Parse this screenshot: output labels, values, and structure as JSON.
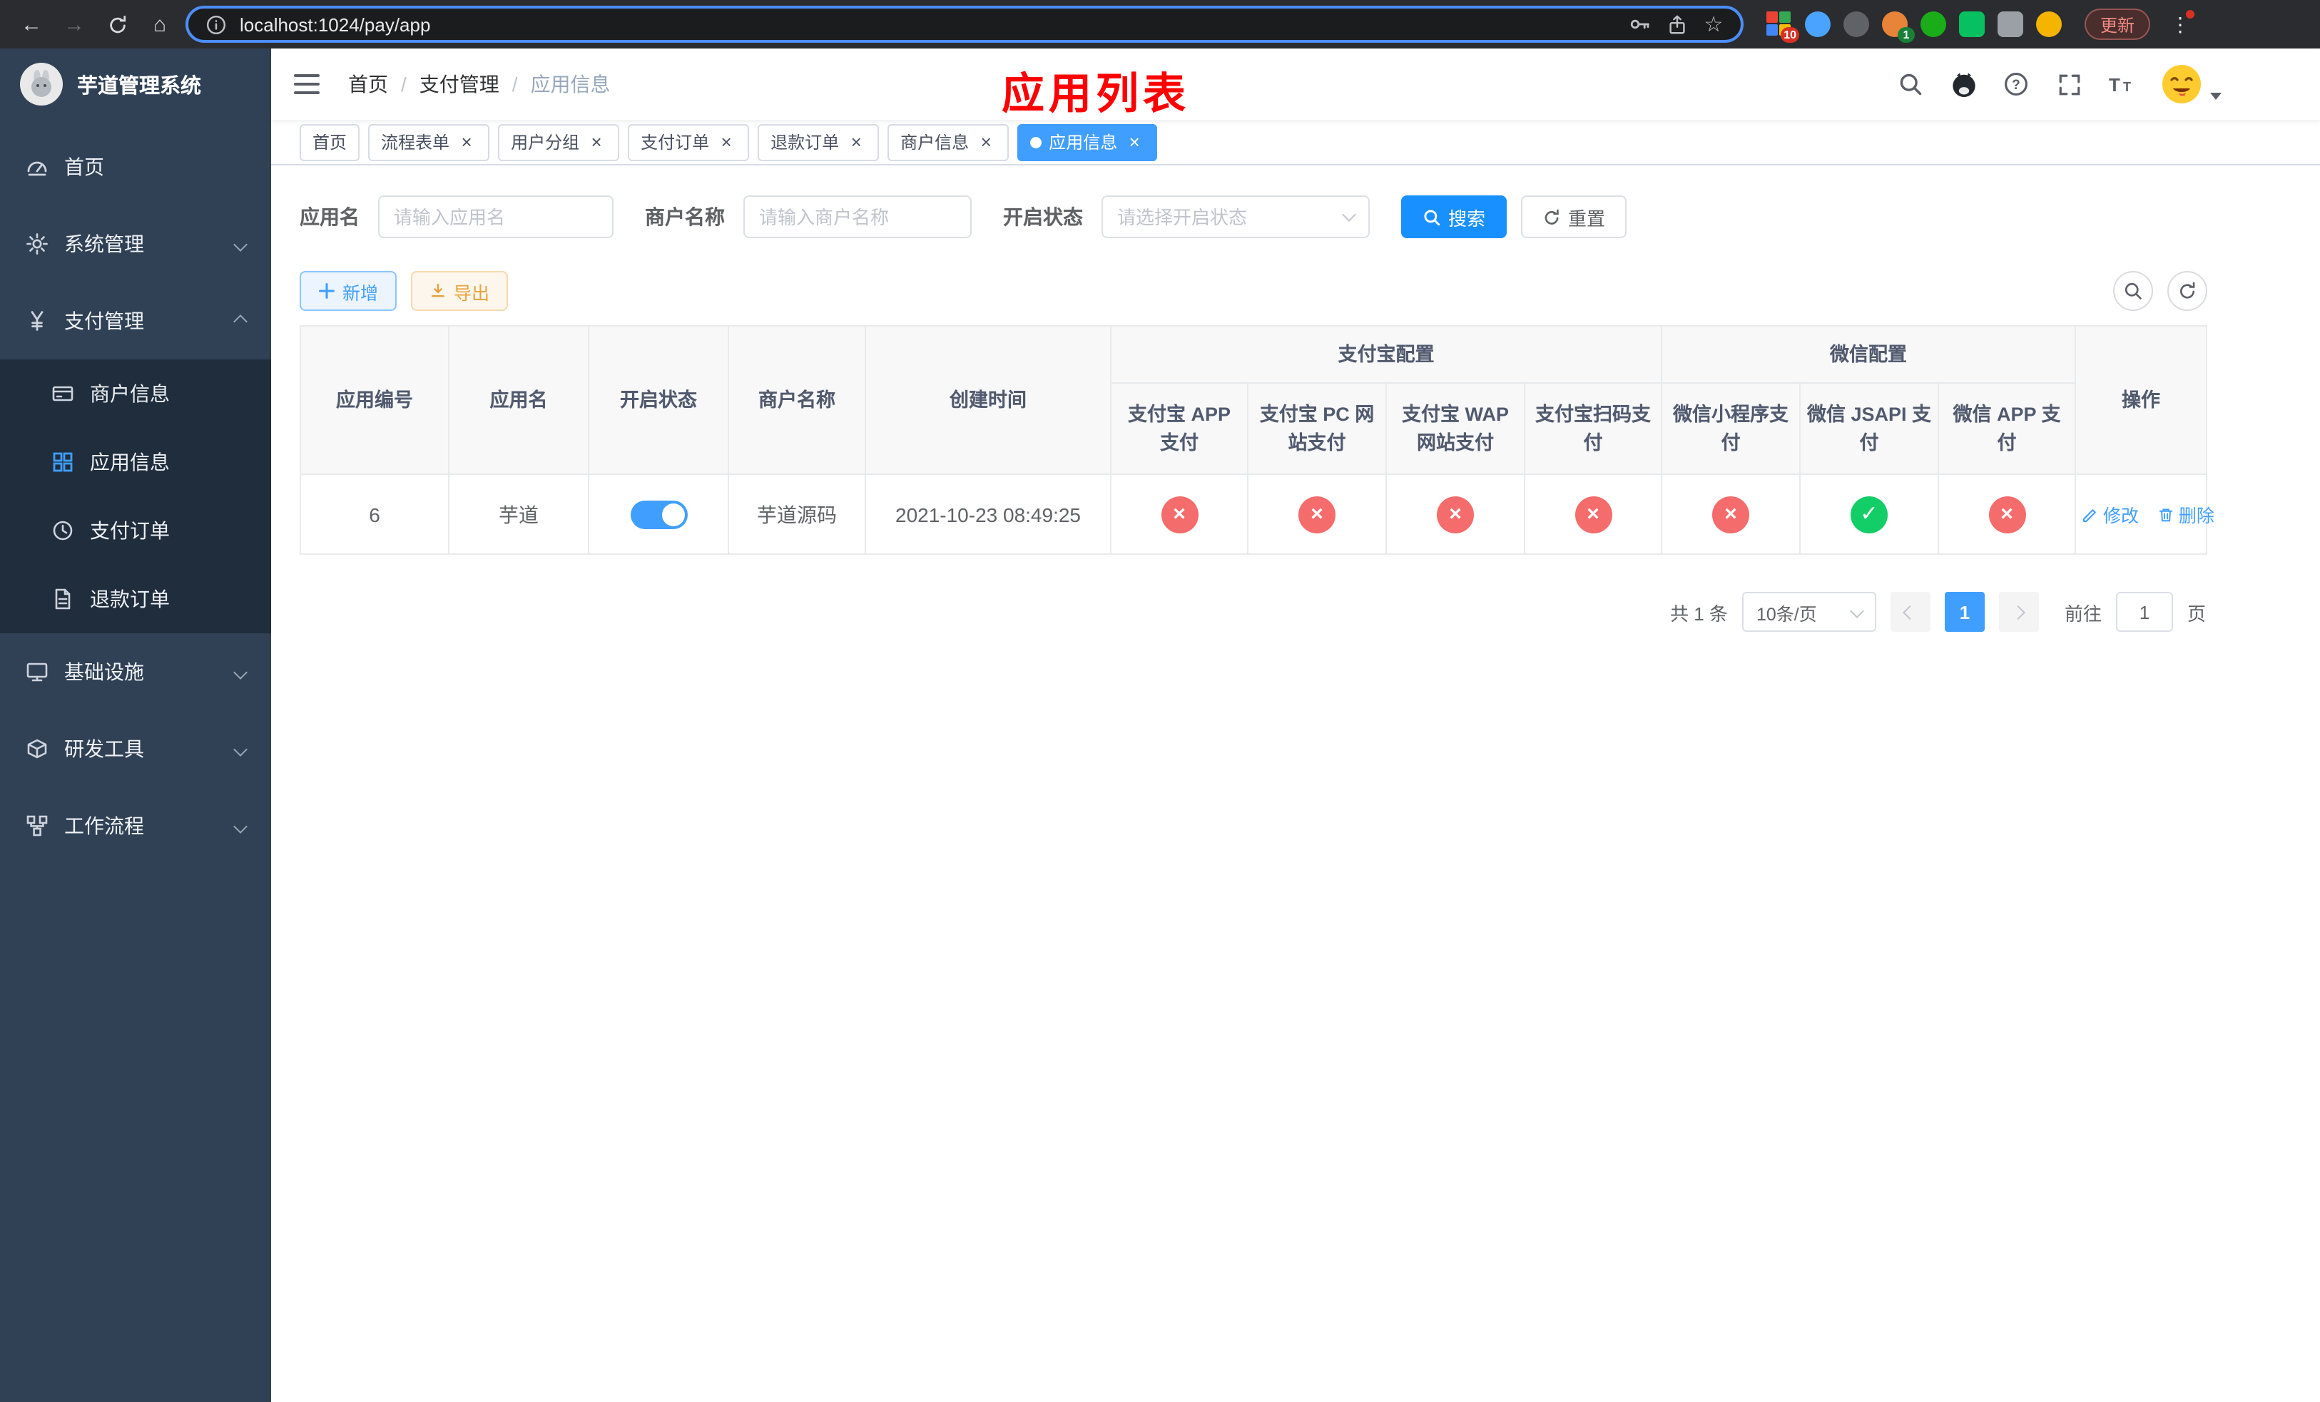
{
  "browser": {
    "url": "localhost:1024/pay/app",
    "update_button": "更新",
    "extension_badge": "10",
    "avatar_badge": "1"
  },
  "sidebar": {
    "title": "芋道管理系统",
    "items": [
      {
        "label": "首页",
        "icon": "dashboard-icon"
      },
      {
        "label": "系统管理",
        "icon": "gear-icon",
        "chevron": "down"
      },
      {
        "label": "支付管理",
        "icon": "yen-icon",
        "chevron": "up",
        "children": [
          {
            "label": "商户信息",
            "icon": "card-icon"
          },
          {
            "label": "应用信息",
            "icon": "grid-icon",
            "active": true
          },
          {
            "label": "支付订单",
            "icon": "clock-icon"
          },
          {
            "label": "退款订单",
            "icon": "document-icon"
          }
        ]
      },
      {
        "label": "基础设施",
        "icon": "monitor-icon",
        "chevron": "down"
      },
      {
        "label": "研发工具",
        "icon": "box-icon",
        "chevron": "down"
      },
      {
        "label": "工作流程",
        "icon": "workflow-icon",
        "chevron": "down"
      }
    ]
  },
  "header": {
    "breadcrumb": [
      "首页",
      "支付管理",
      "应用信息"
    ],
    "separator": "/",
    "overlay_title": "应用列表",
    "icons": [
      "search",
      "github",
      "help",
      "fullscreen",
      "font-size",
      "avatar",
      "caret-down"
    ]
  },
  "tabs": [
    {
      "label": "首页",
      "closable": false,
      "active": false
    },
    {
      "label": "流程表单",
      "closable": true,
      "active": false
    },
    {
      "label": "用户分组",
      "closable": true,
      "active": false
    },
    {
      "label": "支付订单",
      "closable": true,
      "active": false
    },
    {
      "label": "退款订单",
      "closable": true,
      "active": false
    },
    {
      "label": "商户信息",
      "closable": true,
      "active": false
    },
    {
      "label": "应用信息",
      "closable": true,
      "active": true
    }
  ],
  "filters": {
    "app_name_label": "应用名",
    "app_name_placeholder": "请输入应用名",
    "merchant_label": "商户名称",
    "merchant_placeholder": "请输入商户名称",
    "status_label": "开启状态",
    "status_placeholder": "请选择开启状态",
    "search_button": "搜索",
    "reset_button": "重置"
  },
  "toolbar": {
    "add_button": "新增",
    "export_button": "导出"
  },
  "table": {
    "group_headers": {
      "alipay": "支付宝配置",
      "wechat": "微信配置"
    },
    "columns": [
      "应用编号",
      "应用名",
      "开启状态",
      "商户名称",
      "创建时间",
      "支付宝 APP 支付",
      "支付宝 PC 网站支付",
      "支付宝 WAP 网站支付",
      "支付宝扫码支付",
      "微信小程序支付",
      "微信 JSAPI 支付",
      "微信 APP 支付",
      "操作"
    ],
    "rows": [
      {
        "id": "6",
        "name": "芋道",
        "enabled": true,
        "merchant": "芋道源码",
        "created": "2021-10-23 08:49:25",
        "statuses": [
          false,
          false,
          false,
          false,
          false,
          true,
          false
        ],
        "edit_label": "修改",
        "delete_label": "删除"
      }
    ]
  },
  "pagination": {
    "total_text": "共 1 条",
    "page_size": "10条/页",
    "current_page": "1",
    "goto_label": "前往",
    "goto_value": "1",
    "page_suffix": "页"
  },
  "colors": {
    "accent": "#409eff",
    "primary_button": "#1890ff",
    "danger": "#f56c6c",
    "success": "#13ce66",
    "warning": "#e6a23c",
    "overlay_title_red": "#ff0000",
    "sidebar_bg": "#304156",
    "submenu_bg": "#1f2d3d"
  }
}
